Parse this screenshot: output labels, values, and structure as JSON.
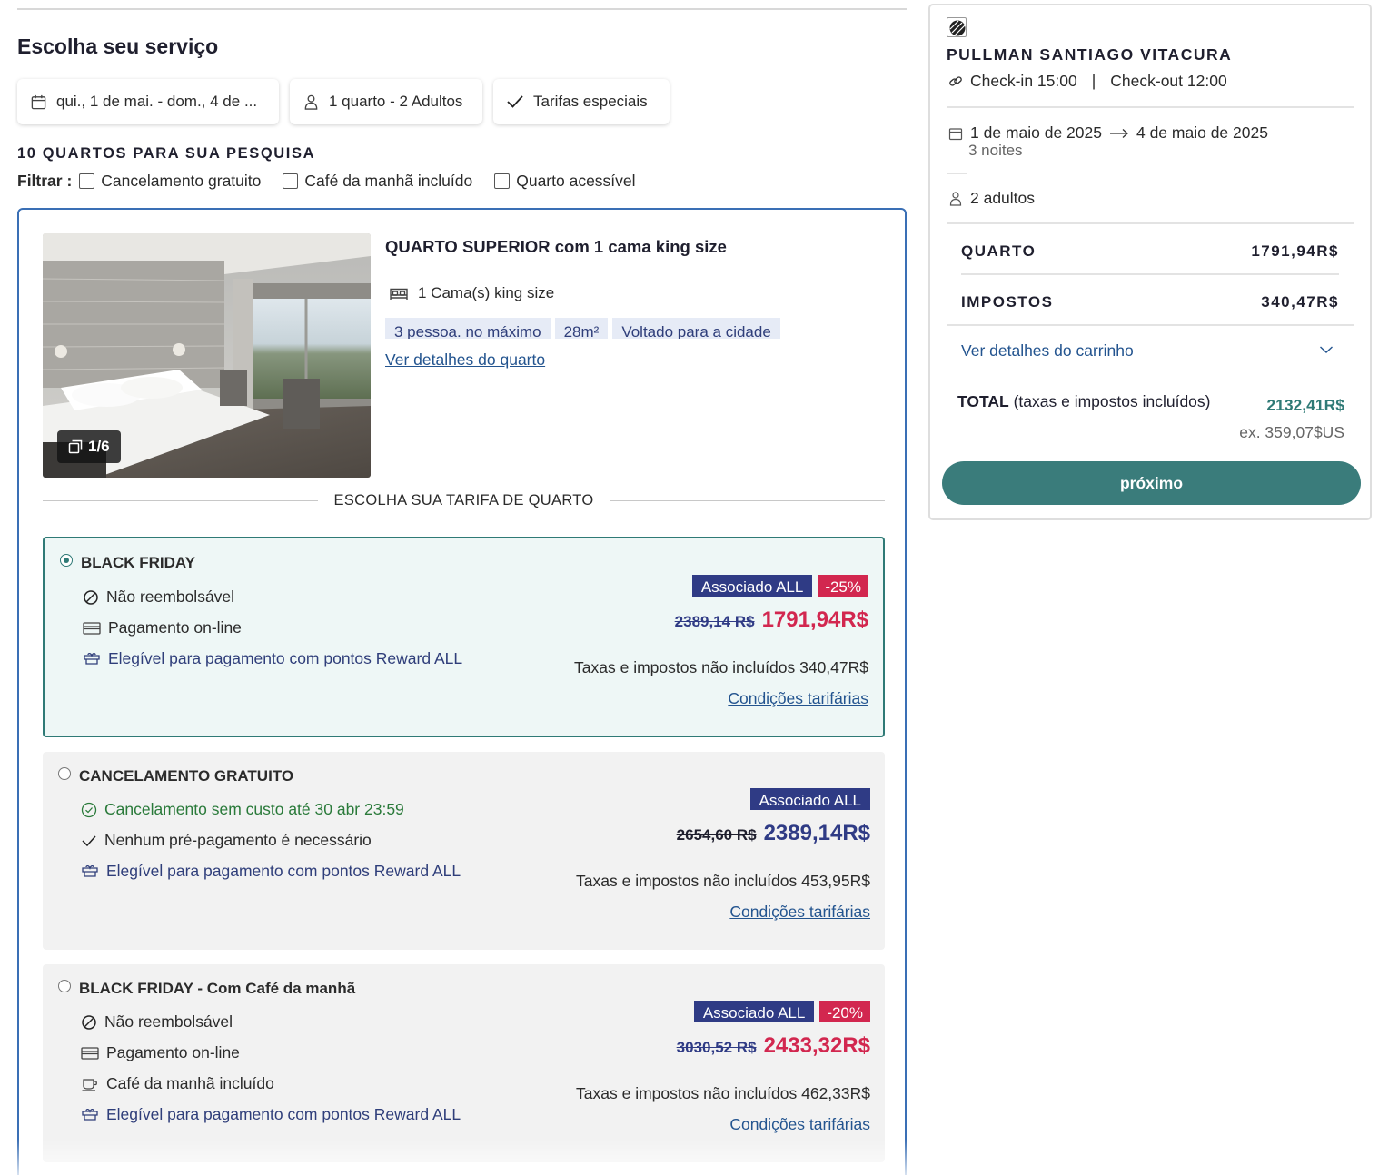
{
  "page_title": "Escolha seu serviço",
  "search": {
    "dates": "qui., 1 de mai. - dom., 4 de ...",
    "rooms": "1 quarto - 2 Adultos",
    "special_rates": "Tarifas especiais"
  },
  "results_count": "10 QUARTOS PARA SUA PESQUISA",
  "filters": {
    "label": "Filtrar :",
    "options": [
      "Cancelamento gratuito",
      "Café da manhã incluído",
      "Quarto acessível"
    ]
  },
  "room": {
    "photo_counter": "1/6",
    "title": "QUARTO SUPERIOR com 1 cama king size",
    "bed": "1 Cama(s) king size",
    "tags": [
      "3 pessoa. no máximo",
      "28m²",
      "Voltado para a cidade"
    ],
    "details_link": "Ver detalhes do quarto",
    "rate_divider": "ESCOLHA SUA TARIFA DE QUARTO",
    "rates": [
      {
        "name": "BLACK FRIDAY",
        "features": [
          "Não reembolsável",
          "Pagamento on-line",
          "Elegível para pagamento com pontos Reward ALL"
        ],
        "badge": "Associado ALL",
        "discount": "-25%",
        "old_price": "2389,14 R$",
        "price": "1791,94R$",
        "taxes": "Taxas e impostos não incluídos 340,47R$",
        "conditions": "Condições tarifárias"
      },
      {
        "name": "CANCELAMENTO GRATUITO",
        "features": [
          "Cancelamento sem custo até 30 abr 23:59",
          "Nenhum pré-pagamento é necessário",
          "Elegível para pagamento com pontos Reward ALL"
        ],
        "badge": "Associado ALL",
        "old_price": "2654,60 R$",
        "price": "2389,14R$",
        "taxes": "Taxas e impostos não incluídos 453,95R$",
        "conditions": "Condições tarifárias"
      },
      {
        "name": "BLACK FRIDAY - Com Café da manhã",
        "features": [
          "Não reembolsável",
          "Pagamento on-line",
          "Café da manhã incluído",
          "Elegível para pagamento com pontos Reward ALL"
        ],
        "badge": "Associado ALL",
        "discount": "-20%",
        "old_price": "3030,52 R$",
        "price": "2433,32R$",
        "taxes": "Taxas e impostos não incluídos 462,33R$",
        "conditions": "Condições tarifárias"
      }
    ]
  },
  "summary": {
    "hotel_name": "PULLMAN SANTIAGO VITACURA",
    "checkin": "Check-in 15:00",
    "checkout": "Check-out 12:00",
    "separator": "|",
    "date_from": "1 de maio de 2025",
    "date_to": "4 de maio de 2025",
    "nights": "3 noites",
    "guests": "2 adultos",
    "room_label": "QUARTO",
    "room_price": "1791,94R$",
    "tax_label": "IMPOSTOS",
    "tax_price": "340,47R$",
    "cart_link": "Ver detalhes do carrinho",
    "total_label": "TOTAL",
    "total_note": "(taxas e impostos incluídos)",
    "total_value": "2132,41R$",
    "total_usd": "ex. 359,07$US",
    "next_button": "próximo"
  },
  "colors": {
    "accent_teal": "#3a7c7b",
    "discount_red": "#d2274f",
    "member_navy": "#2f3b85",
    "link_blue": "#23548f",
    "card_border": "#3a6fb5"
  }
}
